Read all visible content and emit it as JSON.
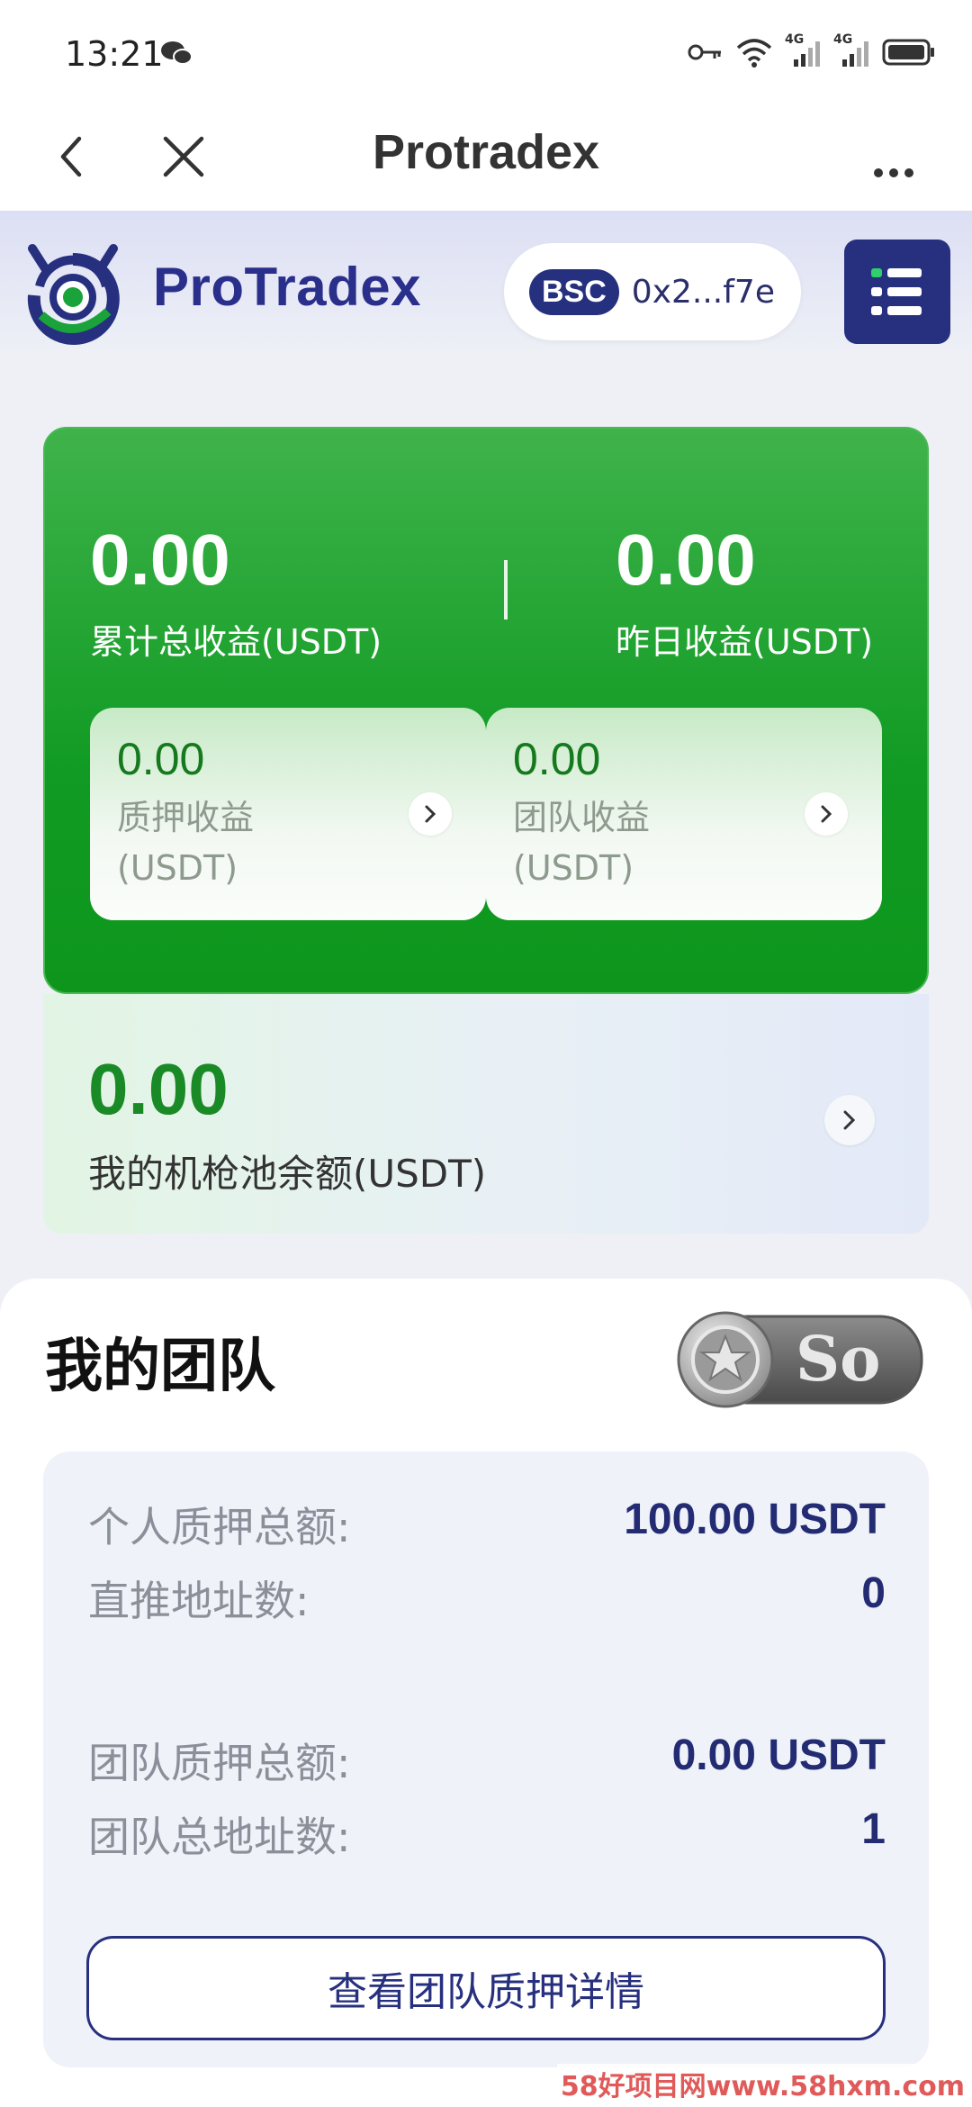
{
  "status_bar": {
    "time": "13:21",
    "wechat_icon": "wechat-icon",
    "key_icon": "key-icon",
    "wifi_icon": "wifi-icon",
    "signal1": "4G",
    "signal2": "4G",
    "battery_icon": "battery-icon"
  },
  "nav": {
    "title": "Protradex",
    "back_icon": "back-arrow-icon",
    "close_icon": "close-icon",
    "more_icon": "more-icon"
  },
  "header": {
    "logo_text": "ProTradex",
    "chain": "BSC",
    "address": "0x2...f7e",
    "menu_icon": "menu-icon"
  },
  "earnings": {
    "total_value": "0.00",
    "total_label": "累计总收益(USDT)",
    "yesterday_value": "0.00",
    "yesterday_label": "昨日收益(USDT)",
    "staking_value": "0.00",
    "staking_label": "质押收益\n(USDT)",
    "team_value": "0.00",
    "team_label": "团队收益\n(USDT)"
  },
  "pool": {
    "value": "0.00",
    "label": "我的机枪池余额(USDT)"
  },
  "team": {
    "title": "我的团队",
    "rank": "So",
    "rows": [
      {
        "label": "个人质押总额:",
        "value": "100.00 USDT"
      },
      {
        "label": "直推地址数:",
        "value": "0"
      },
      {
        "label": "团队质押总额:",
        "value": "0.00 USDT"
      },
      {
        "label": "团队总地址数:",
        "value": "1"
      }
    ],
    "detail_button": "查看团队质押详情"
  },
  "watermark": "58好项目网www.58hxm.com",
  "colors": {
    "brand_navy": "#27307f",
    "earn_green": "#119b24",
    "pool_green": "#1a8a26"
  }
}
